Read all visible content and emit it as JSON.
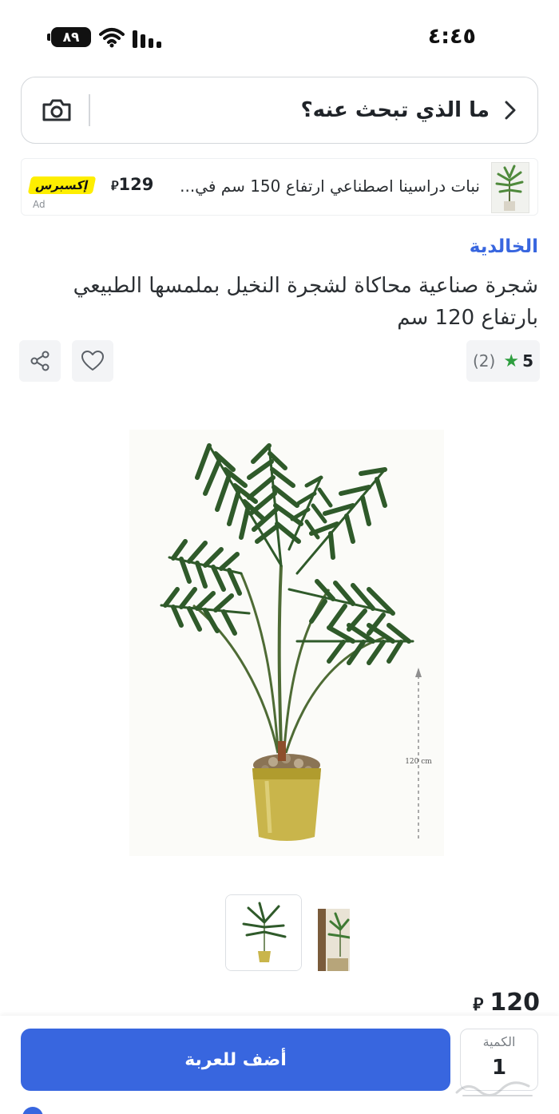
{
  "status_bar": {
    "time": "٤:٤٥",
    "battery": "٨٩"
  },
  "search": {
    "placeholder": "ما الذي تبحث عنه؟"
  },
  "ad": {
    "title": "نبات دراسينا اصطناعي ارتفاع 150 سم في...",
    "price": "129",
    "badge": "إكسبرس",
    "label": "Ad"
  },
  "product": {
    "seller": "الخالدية",
    "title": "شجرة صناعية محاكاة لشجرة النخيل بملمسها الطبيعي بارتفاع 120 سم",
    "rating": {
      "score": "5",
      "count": "(2)"
    },
    "image_dimension_label": "120 cm",
    "price": "120"
  },
  "cart": {
    "add_label": "أضف للعربة",
    "quantity_label": "الكمية",
    "quantity_value": "1"
  },
  "icons": {
    "search_back": "chevron-right-icon",
    "camera": "camera-icon",
    "share": "share-icon",
    "wishlist": "heart-icon",
    "star": "star-icon",
    "currency": "riyal-icon"
  },
  "colors": {
    "brand": "#3866df",
    "express": "#feee00",
    "star": "#2e9e3f"
  }
}
